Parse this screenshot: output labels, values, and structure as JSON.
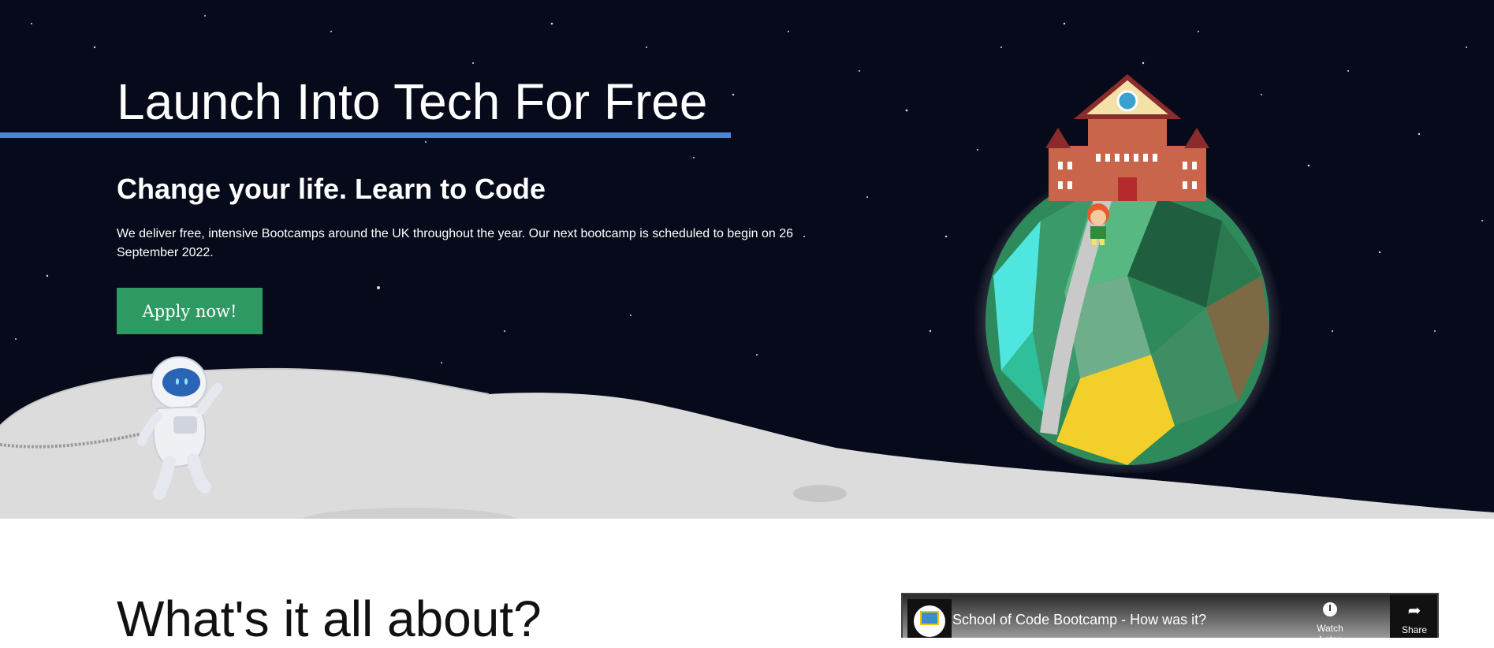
{
  "hero": {
    "title": "Launch Into Tech For Free",
    "subtitle": "Change your life. Learn to Code",
    "description": "We deliver free, intensive Bootcamps around the UK throughout the year. Our next bootcamp is scheduled to begin on 26 September 2022.",
    "apply_label": "Apply now!"
  },
  "about": {
    "title": "What's it all about?"
  },
  "video": {
    "title": "School of Code Bootcamp - How was it?",
    "watch_later_label": "Watch Later",
    "share_label": "Share"
  },
  "colors": {
    "hero_background": "#060a1a",
    "underline": "#4a86d9",
    "apply_button": "#2e9a63",
    "moon": "#d9d9d9"
  },
  "icons": [
    "clock-icon",
    "share-icon",
    "school-logo-icon"
  ]
}
